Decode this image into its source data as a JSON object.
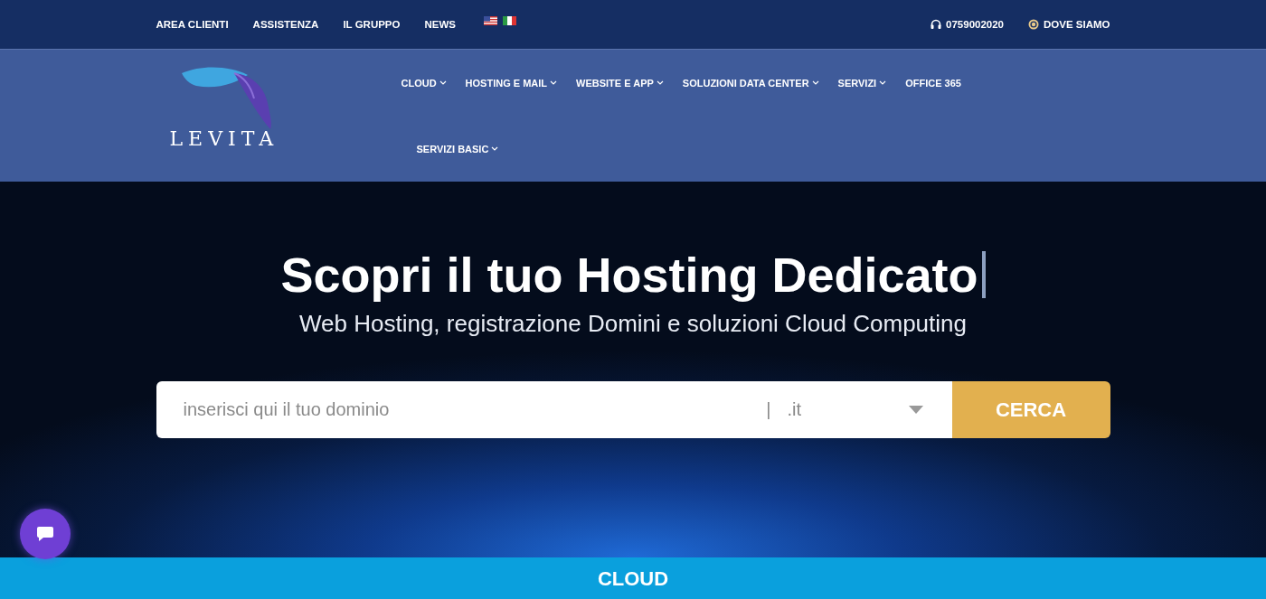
{
  "top_bar": {
    "links": [
      "AREA CLIENTI",
      "ASSISTENZA",
      "IL GRUPPO",
      "NEWS"
    ],
    "languages": [
      {
        "kind": "us"
      },
      {
        "kind": "it"
      }
    ],
    "phone": "0759002020",
    "location": "DOVE SIAMO"
  },
  "nav": {
    "logo": "LEVITA",
    "items": [
      {
        "label": "CLOUD",
        "dropdown": true
      },
      {
        "label": "HOSTING E MAIL",
        "dropdown": true
      },
      {
        "label": "WEBSITE E APP",
        "dropdown": true
      },
      {
        "label": "SOLUZIONI DATA CENTER",
        "dropdown": true
      },
      {
        "label": "SERVIZI",
        "dropdown": true
      },
      {
        "label": "OFFICE 365",
        "dropdown": false
      },
      {
        "label": "SERVIZI BASIC",
        "dropdown": true
      }
    ]
  },
  "hero": {
    "title": "Scopri il tuo Hosting Dedicato",
    "subtitle": "Web Hosting, registrazione Domini e soluzioni Cloud Computing",
    "search": {
      "placeholder": "inserisci qui il tuo dominio",
      "separator": "|",
      "extension": ".it",
      "button": "CERCA"
    }
  },
  "section": {
    "heading": "CLOUD"
  }
}
